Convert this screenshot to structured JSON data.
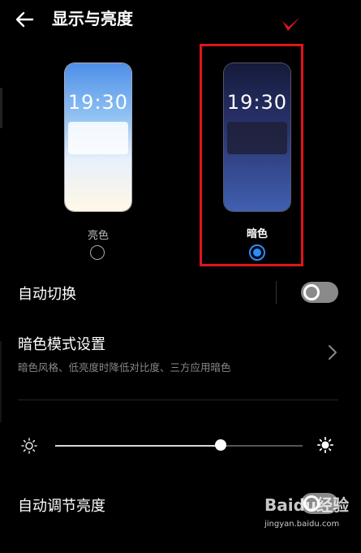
{
  "header": {
    "title": "显示与亮度",
    "back_icon": "arrow-left-icon"
  },
  "theme": {
    "light": {
      "label": "亮色",
      "time": "19:30",
      "selected": false
    },
    "dark": {
      "label": "暗色",
      "time": "19:30",
      "selected": true
    }
  },
  "settings": {
    "auto_switch": {
      "label": "自动切换",
      "enabled": false
    },
    "dark_mode": {
      "label": "暗色模式设置",
      "subtitle": "暗色风格、低亮度时降低对比度、三方应用暗色"
    },
    "brightness": {
      "level": 0.67
    },
    "auto_brightness": {
      "label": "自动调节亮度",
      "enabled": false
    }
  },
  "watermark": {
    "brand": "Baidu经验",
    "url": "jingyan.baidu.com"
  },
  "colors": {
    "highlight": "#e0151a",
    "accent": "#2a8cff",
    "background": "#000000"
  }
}
